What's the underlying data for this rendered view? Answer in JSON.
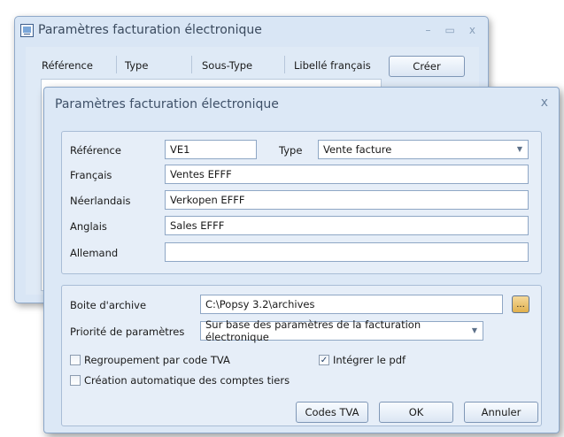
{
  "back_window": {
    "title": "Paramètres facturation électronique",
    "controls": {
      "minimize": "–",
      "maximize": "▭",
      "close": "x"
    },
    "columns": [
      "Référence",
      "Type",
      "Sous-Type",
      "Libellé français"
    ],
    "create_button": "Créer"
  },
  "dialog": {
    "title": "Paramètres facturation électronique",
    "close": "x",
    "reference": {
      "label": "Référence",
      "value": "VE1"
    },
    "type": {
      "label": "Type",
      "value": "Vente facture"
    },
    "francais": {
      "label": "Français",
      "value": "Ventes EFFF"
    },
    "neerlandais": {
      "label": "Néerlandais",
      "value": "Verkopen EFFF"
    },
    "anglais": {
      "label": "Anglais",
      "value": "Sales EFFF"
    },
    "allemand": {
      "label": "Allemand",
      "value": ""
    },
    "boite_archive": {
      "label": "Boite d'archive",
      "value": "C:\\Popsy 3.2\\archives",
      "browse": "..."
    },
    "priorite": {
      "label": "Priorité de paramètres",
      "value": "Sur base des paramètres de la facturation électronique"
    },
    "regroupement": {
      "label": "Regroupement par code TVA",
      "checked": false
    },
    "integrer_pdf": {
      "label": "Intégrer le pdf",
      "checked": true
    },
    "creation_auto": {
      "label": "Création automatique des comptes tiers",
      "checked": false
    },
    "buttons": {
      "codes_tva": "Codes TVA",
      "ok": "OK",
      "annuler": "Annuler"
    }
  }
}
